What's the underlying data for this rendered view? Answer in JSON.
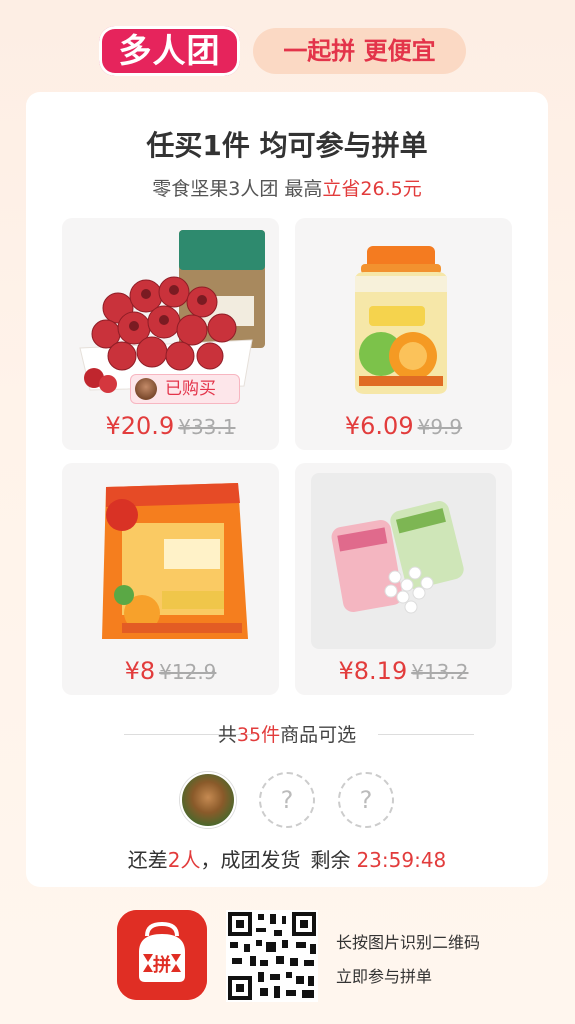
{
  "header": {
    "logo_text": "多人团",
    "slogan": "一起拼 更便宜"
  },
  "card": {
    "title": "任买1件  均可参与拼单",
    "subtitle_prefix": "零食坚果3人团 最高",
    "subtitle_highlight": "立省26.5元"
  },
  "products": [
    {
      "price": "¥20.9",
      "original": "¥33.1",
      "badge": "已购买"
    },
    {
      "price": "¥6.09",
      "original": "¥9.9"
    },
    {
      "price": "¥8",
      "original": "¥12.9"
    },
    {
      "price": "¥8.19",
      "original": "¥13.2"
    }
  ],
  "selection": {
    "prefix": "共",
    "count": "35件",
    "suffix": "商品可选"
  },
  "members": {
    "empty_placeholder": "?"
  },
  "status": {
    "prefix": "还差",
    "count": "2人",
    "suffix": "，成团发货",
    "remain_label": "剩余",
    "timer": "23:59:48"
  },
  "footer": {
    "line1": "长按图片识别二维码",
    "line2": "立即参与拼单",
    "app_logo_text": "拼"
  },
  "colors": {
    "accent": "#e23c3c",
    "brand": "#e02e24",
    "logo_badge": "#e6245c"
  }
}
